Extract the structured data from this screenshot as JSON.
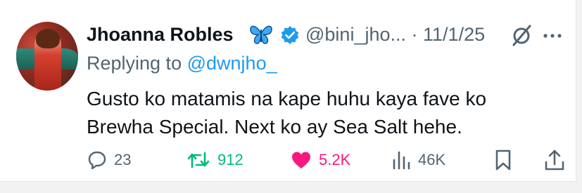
{
  "tweet": {
    "author_name": "Jhoanna Robles",
    "author_emoji": "butterfly",
    "handle": "@bini_jho...",
    "separator": "·",
    "date": "11/1/25",
    "reply_prefix": "Replying to",
    "reply_mention": "@dwnjho_",
    "text_line1": "Gusto ko matamis na kape huhu kaya fave ko",
    "text_line2": "Brewha Special. Next ko ay Sea Salt hehe."
  },
  "actions": {
    "replies": "23",
    "reposts": "912",
    "likes": "5.2K",
    "views": "46K"
  },
  "colors": {
    "accent": "#1d9bf0",
    "muted": "#536471",
    "repost": "#00ba7c",
    "like": "#f91880",
    "butterfly": "#3fa9f5"
  },
  "icons": [
    "butterfly-icon",
    "verified-badge-icon",
    "grok-icon",
    "more-icon",
    "reply-icon",
    "repost-icon",
    "like-icon",
    "views-icon",
    "bookmark-icon",
    "share-icon"
  ]
}
